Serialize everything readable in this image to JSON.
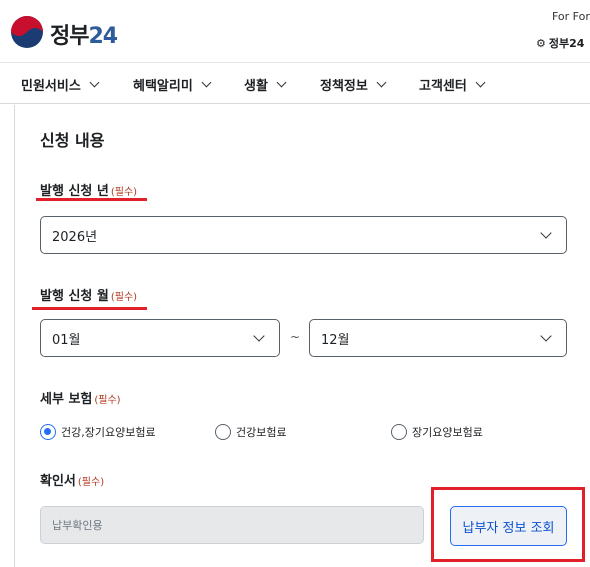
{
  "header": {
    "logo_text_main": "정부",
    "logo_text_num": "24",
    "top_right_1": "For Fore",
    "top_right_2": "정부24"
  },
  "nav": {
    "items": [
      {
        "label": "민원서비스"
      },
      {
        "label": "혜택알리미"
      },
      {
        "label": "생활"
      },
      {
        "label": "정책정보"
      },
      {
        "label": "고객센터"
      }
    ]
  },
  "form": {
    "section_title": "신청 내용",
    "required_mark": "(필수)",
    "year": {
      "label": "발행 신청 년",
      "value": "2026년"
    },
    "month": {
      "label": "발행 신청 월",
      "from": "01월",
      "separator": "~",
      "to": "12월"
    },
    "insurance": {
      "label": "세부 보험",
      "options": [
        {
          "label": "건강,장기요양보험료",
          "checked": true
        },
        {
          "label": "건강보험료",
          "checked": false
        },
        {
          "label": "장기요양보험료",
          "checked": false
        }
      ]
    },
    "certificate": {
      "label": "확인서",
      "value": "납부확인용",
      "lookup_button": "납부자 정보 조회"
    }
  },
  "colors": {
    "accent": "#256ef4",
    "required": "#b1361e",
    "highlight": "#e2202a"
  }
}
